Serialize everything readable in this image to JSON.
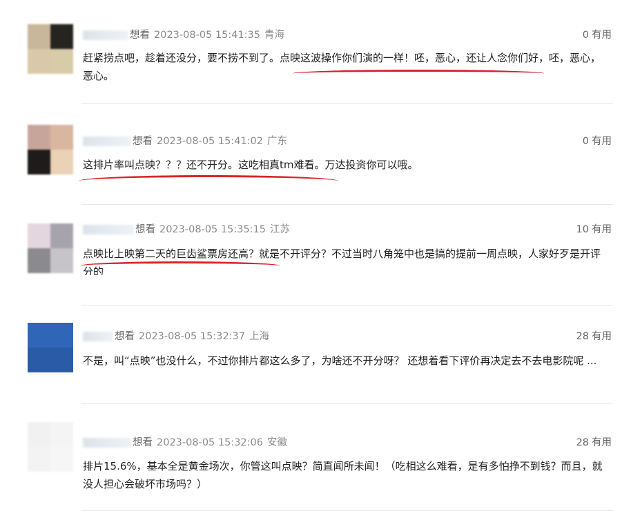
{
  "comments": [
    {
      "watched": "想看",
      "time": "2023-08-05 15:41:35",
      "region": "青海",
      "useful_count": "0",
      "useful_label": "有用",
      "text": "赶紧捞点吧，趁着还没分，要不捞不到了。点映这波操作你们演的一样！呸，恶心，还让人念你们好，呸，恶心，恶心。"
    },
    {
      "watched": "想看",
      "time": "2023-08-05 15:41:02",
      "region": "广东",
      "useful_count": "0",
      "useful_label": "有用",
      "text": "这排片率叫点映？？？还不开分。这吃相真tm难看。万达投资你可以哦。"
    },
    {
      "watched": "想看",
      "time": "2023-08-05 15:35:15",
      "region": "江苏",
      "useful_count": "10",
      "useful_label": "有用",
      "text": "点映比上映第二天的巨齿鲨票房还高？就是不开评分？不过当时八角笼中也是搞的提前一周点映，人家好歹是开评分的"
    },
    {
      "watched": "想看",
      "time": "2023-08-05 15:32:37",
      "region": "上海",
      "useful_count": "28",
      "useful_label": "有用",
      "text": "不是，叫“点映”也没什么，不过你排片都这么多了，为啥还不开分呀？ 还想着看下评价再决定去不去电影院呢 ..."
    },
    {
      "watched": "想看",
      "time": "2023-08-05 15:32:06",
      "region": "安徽",
      "useful_count": "28",
      "useful_label": "有用",
      "text": "排片15.6%，基本全是黄金场次，你管这叫点映？简直闻所未闻！（吃相这么难看，是有多怕挣不到钱？而且，就没人担心会破坏市场吗？）"
    }
  ],
  "colors": {
    "annotation_red": "#d8232a",
    "meta_gray": "#8a8a8a"
  }
}
